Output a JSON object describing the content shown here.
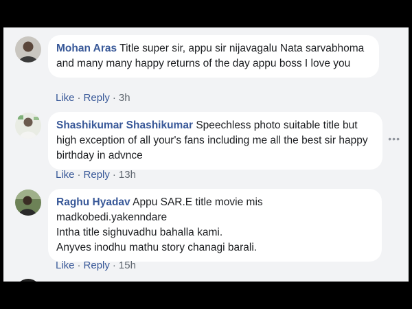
{
  "comments": [
    {
      "author": "Mohan Aras",
      "text": "Title super sir, appu sir nijavagalu Nata sarvabhoma and many many happy returns of the day appu boss I love you",
      "like_label": "Like",
      "reply_label": "Reply",
      "time": "3h"
    },
    {
      "author": "Shashikumar Shashikumar",
      "text": "Speechless photo suitable title but high exception of all your's fans including me all the best sir happy birthday in advnce",
      "like_label": "Like",
      "reply_label": "Reply",
      "time": "13h"
    },
    {
      "author": "Raghu Hyadav",
      "text_lines": [
        "Appu SAR.E title movie mis",
        "madkobedi.yakenndare",
        "Intha title sighuvadhu bahalla kami.",
        "Anyves inodhu mathu story chanagi barali."
      ],
      "like_label": "Like",
      "reply_label": "Reply",
      "time": "15h"
    }
  ],
  "colors": {
    "author": "#385898",
    "background": "#f2f3f5",
    "bubble": "#ffffff",
    "meta": "#606770"
  },
  "icons": {
    "more": "more-options-icon",
    "avatar": "user-avatar"
  },
  "more_glyph": "•••"
}
